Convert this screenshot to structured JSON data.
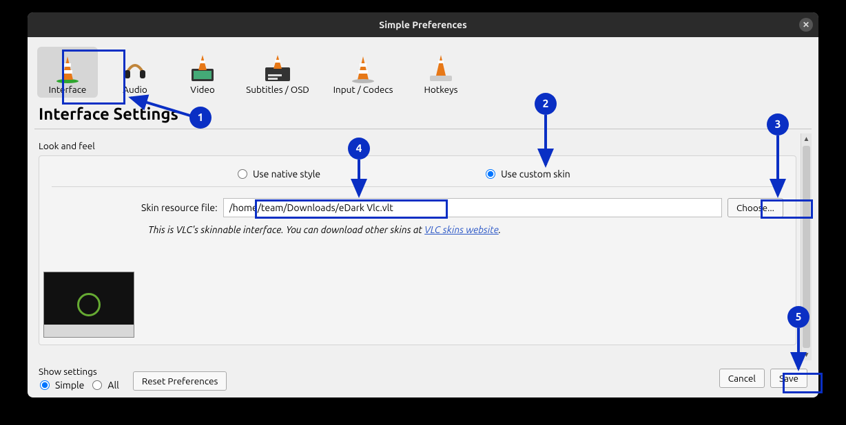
{
  "title": "Simple Preferences",
  "tabs": {
    "interface": "Interface",
    "audio": "Audio",
    "video": "Video",
    "subtitles": "Subtitles / OSD",
    "input": "Input / Codecs",
    "hotkeys": "Hotkeys"
  },
  "section_heading": "Interface Settings",
  "look_and_feel": {
    "group_label": "Look and feel",
    "native_label": "Use native style",
    "custom_label": "Use custom skin",
    "skin_file_label": "Skin resource file:",
    "skin_file_value": "/home/team/Downloads/eDark Vlc.vlt",
    "choose_button": "Choose...",
    "desc_prefix": "This is VLC's skinnable interface. You can download other skins at ",
    "desc_link_text": "VLC skins website",
    "desc_suffix": "."
  },
  "show_settings": {
    "label": "Show settings",
    "simple": "Simple",
    "all": "All"
  },
  "buttons": {
    "reset": "Reset Preferences",
    "cancel": "Cancel",
    "save": "Save"
  },
  "annotations": {
    "n1": "1",
    "n2": "2",
    "n3": "3",
    "n4": "4",
    "n5": "5"
  }
}
